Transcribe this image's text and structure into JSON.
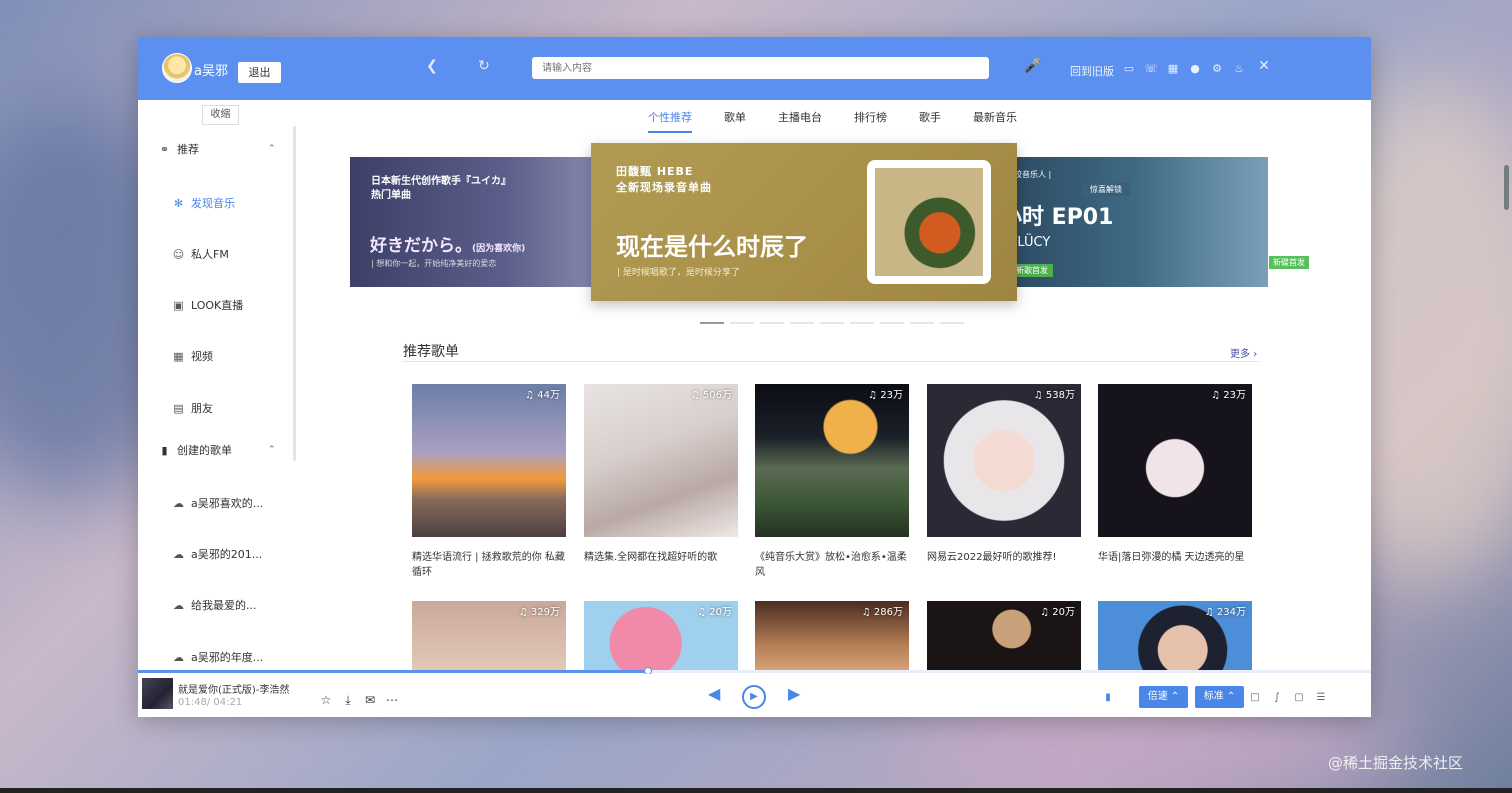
{
  "header": {
    "username": "a吴邪",
    "logout": "退出",
    "search_placeholder": "请输入内容",
    "back_old": "回到旧版"
  },
  "collapse_label": "收缩",
  "sidebar": {
    "group_recommend": "推荐",
    "items": [
      "发现音乐",
      "私人FM",
      "LOOK直播",
      "视频",
      "朋友"
    ],
    "group_created": "创建的歌单",
    "playlists": [
      "a吴邪喜欢的...",
      "a吴邪的201...",
      "给我最爱的...",
      "a吴邪的年度..."
    ]
  },
  "tabs": [
    "个性推荐",
    "歌单",
    "主播电台",
    "排行榜",
    "歌手",
    "最新音乐"
  ],
  "banner": {
    "left": {
      "title_line1": "日本新生代创作歌手『ユイカ』",
      "title_line2": "热门单曲",
      "big": "好きだから。",
      "big_note": "(因为喜欢你)",
      "sub": "| 想和你一起，开始纯净美好的爱恋"
    },
    "center": {
      "artist": "田馥甄 HEBE",
      "type": "全新现场录音单曲",
      "big": "现在是什么时辰了",
      "sub": "| 是时候唱歌了，是时候分享了"
    },
    "right": {
      "artist": "黑胶音乐人 |",
      "tag": "惊喜解锁",
      "big": "小时 EP01",
      "sub": "度/LÜCY",
      "badge": "新歌首发",
      "corner": "新碟首发"
    }
  },
  "section": {
    "title": "推荐歌单",
    "more": "更多"
  },
  "playlists_row1": [
    {
      "count": "44万",
      "name": "精选华语流行 | 拯救歌荒的你 私藏循环"
    },
    {
      "count": "506万",
      "name": "精选集.全网都在找超好听的歌"
    },
    {
      "count": "23万",
      "name": "《纯音乐大赏》放松•治愈系•温柔风"
    },
    {
      "count": "538万",
      "name": "网易云2022最好听的歌推荐!"
    },
    {
      "count": "23万",
      "name": "华语|落日弥漫的橘 天边透亮的星"
    }
  ],
  "playlists_row2": [
    {
      "count": "329万"
    },
    {
      "count": "20万"
    },
    {
      "count": "286万"
    },
    {
      "count": "20万"
    },
    {
      "count": "234万"
    }
  ],
  "player": {
    "title": "就是爱你(正式版)-李浩然",
    "time": "01:48/ 04:21",
    "progress": 0.414,
    "speed": "倍速",
    "quality": "标准"
  },
  "watermark": "@稀土掘金技术社区",
  "colors": {
    "header": "#5b8ff0",
    "accent": "#4a86e8"
  }
}
